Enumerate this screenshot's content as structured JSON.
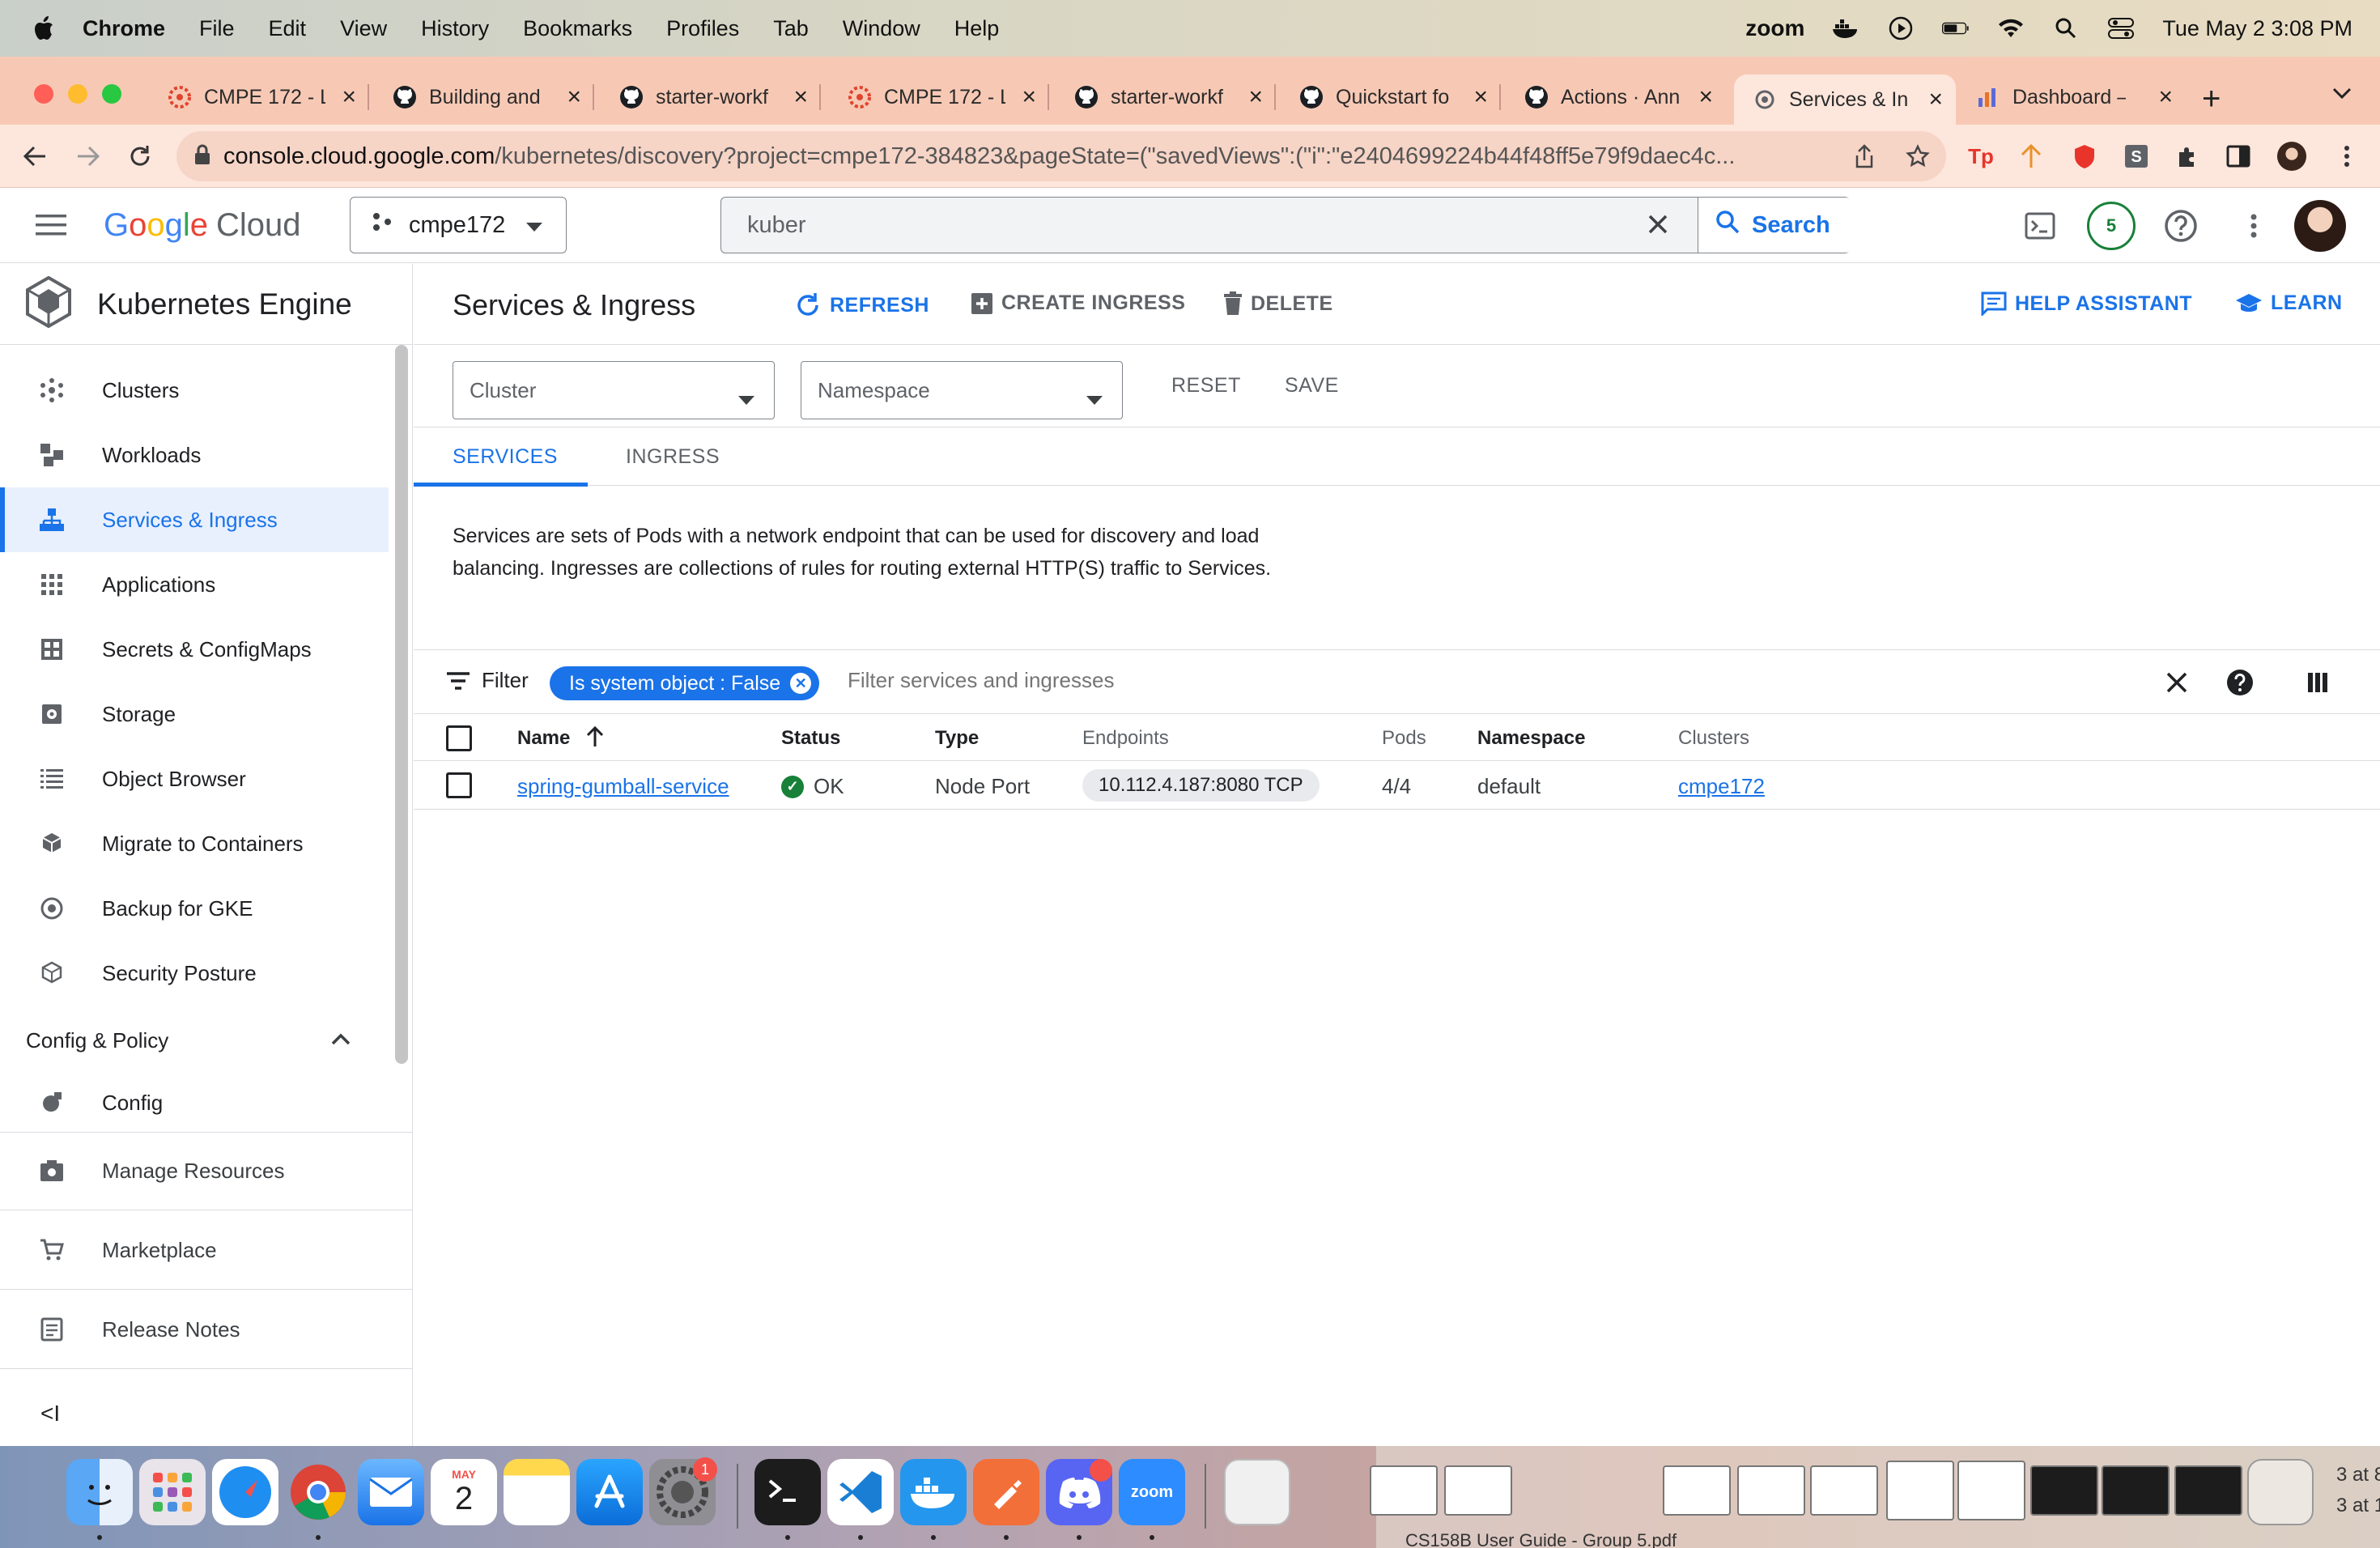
{
  "menubar": {
    "app": "Chrome",
    "items": [
      "File",
      "Edit",
      "View",
      "History",
      "Bookmarks",
      "Profiles",
      "Tab",
      "Window",
      "Help"
    ],
    "zoom_label": "zoom",
    "datetime": "Tue May 2  3:08 PM"
  },
  "tabs": [
    {
      "title": "CMPE 172 - L",
      "favicon": "canvas-icon"
    },
    {
      "title": "Building and",
      "favicon": "github-icon"
    },
    {
      "title": "starter-workf",
      "favicon": "github-icon"
    },
    {
      "title": "CMPE 172 - L",
      "favicon": "canvas-icon"
    },
    {
      "title": "starter-workf",
      "favicon": "github-icon"
    },
    {
      "title": "Quickstart fo",
      "favicon": "github-icon"
    },
    {
      "title": "Actions · Ann",
      "favicon": "github-icon"
    },
    {
      "title": "Services & In",
      "favicon": "gcp-icon",
      "active": true
    },
    {
      "title": "Dashboard –",
      "favicon": "dashboard-icon"
    }
  ],
  "address": {
    "host": "console.cloud.google.com",
    "path": "/kubernetes/discovery?project=cmpe172-384823&pageState=(\"savedViews\":(\"i\":\"e2404699224b44f48ff5e79f9daec4c..."
  },
  "header": {
    "logo_google": [
      "G",
      "o",
      "o",
      "g",
      "l",
      "e"
    ],
    "logo_cloud": "Cloud",
    "project": "cmpe172",
    "search_value": "kuber",
    "search_button": "Search",
    "notifications": "5"
  },
  "sidenav": {
    "title": "Kubernetes Engine",
    "items": [
      {
        "label": "Clusters"
      },
      {
        "label": "Workloads"
      },
      {
        "label": "Services & Ingress"
      },
      {
        "label": "Applications"
      },
      {
        "label": "Secrets & ConfigMaps"
      },
      {
        "label": "Storage"
      },
      {
        "label": "Object Browser"
      },
      {
        "label": "Migrate to Containers"
      },
      {
        "label": "Backup for GKE"
      },
      {
        "label": "Security Posture"
      }
    ],
    "section_config": "Config & Policy",
    "config_item": "Config",
    "manage_resources": "Manage Resources",
    "marketplace": "Marketplace",
    "release_notes": "Release Notes",
    "collapse": "<I"
  },
  "main": {
    "title": "Services & Ingress",
    "refresh": "REFRESH",
    "create_ingress": "CREATE INGRESS",
    "delete": "DELETE",
    "help_assistant": "HELP ASSISTANT",
    "learn": "LEARN",
    "cluster_select": "Cluster",
    "namespace_select": "Namespace",
    "reset": "RESET",
    "save": "SAVE",
    "tab_services": "SERVICES",
    "tab_ingress": "INGRESS",
    "description": "Services are sets of Pods with a network endpoint that can be used for discovery and load balancing. Ingresses are collections of rules for routing external HTTP(S) traffic to Services.",
    "filter_label": "Filter",
    "filter_chip": "Is system object : False",
    "filter_placeholder": "Filter services and ingresses"
  },
  "table": {
    "columns": [
      "Name",
      "Status",
      "Type",
      "Endpoints",
      "Pods",
      "Namespace",
      "Clusters"
    ],
    "rows": [
      {
        "name": "spring-gumball-service",
        "status": "OK",
        "type": "Node Port",
        "endpoints": "10.112.4.187:8080 TCP",
        "pods": "4/4",
        "namespace": "default",
        "clusters": "cmpe172"
      }
    ]
  },
  "dock": {
    "calendar_month": "MAY",
    "calendar_day": "2",
    "badge_settings": "1",
    "zoom": "zoom",
    "finder_snippets": [
      "3 at 8",
      "3 at 1",
      "3 at 1"
    ],
    "finder_row": "CS158B User Guide - Group 5.pdf"
  },
  "colors": {
    "accent": "#1a73e8",
    "ok": "#188038",
    "tabstrip": "#f7c9b5"
  }
}
